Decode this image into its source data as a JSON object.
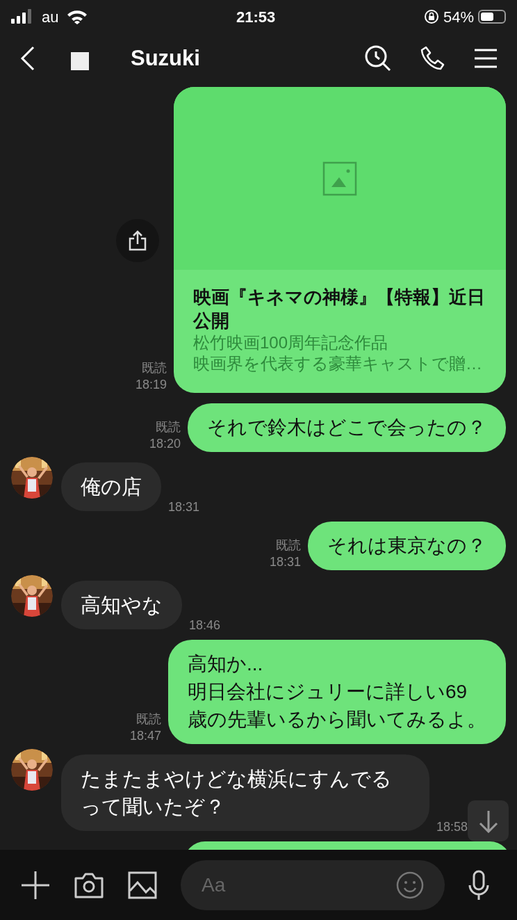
{
  "status_bar": {
    "carrier": "au",
    "time": "21:53",
    "battery": "54%"
  },
  "header": {
    "title": "Suzuki"
  },
  "messages": [
    {
      "kind": "link_card",
      "outgoing": true,
      "title": "映画『キネマの神様』【特報】近日公開",
      "description": [
        "松竹映画100周年記念作品",
        "映画界を代表する豪華キャストで贈…"
      ],
      "read": "既読",
      "time": "18:19"
    },
    {
      "kind": "text",
      "outgoing": true,
      "text": "それで鈴木はどこで会ったの？",
      "read": "既読",
      "time": "18:20"
    },
    {
      "kind": "text",
      "outgoing": false,
      "text": "俺の店",
      "time": "18:31"
    },
    {
      "kind": "text",
      "outgoing": true,
      "text": "それは東京なの？",
      "read": "既読",
      "time": "18:31"
    },
    {
      "kind": "text",
      "outgoing": false,
      "text": "高知やな",
      "time": "18:46"
    },
    {
      "kind": "text",
      "outgoing": true,
      "text": "高知か...\n明日会社にジュリーに詳しい69\n歳の先輩いるから聞いてみるよ。",
      "read": "既読",
      "time": "18:47"
    },
    {
      "kind": "text",
      "outgoing": false,
      "text": "たまたまやけどな横浜にすんでるって聞いたぞ？",
      "time": "18:58"
    },
    {
      "kind": "stub",
      "outgoing": true
    }
  ],
  "composer": {
    "placeholder": "Aa"
  }
}
